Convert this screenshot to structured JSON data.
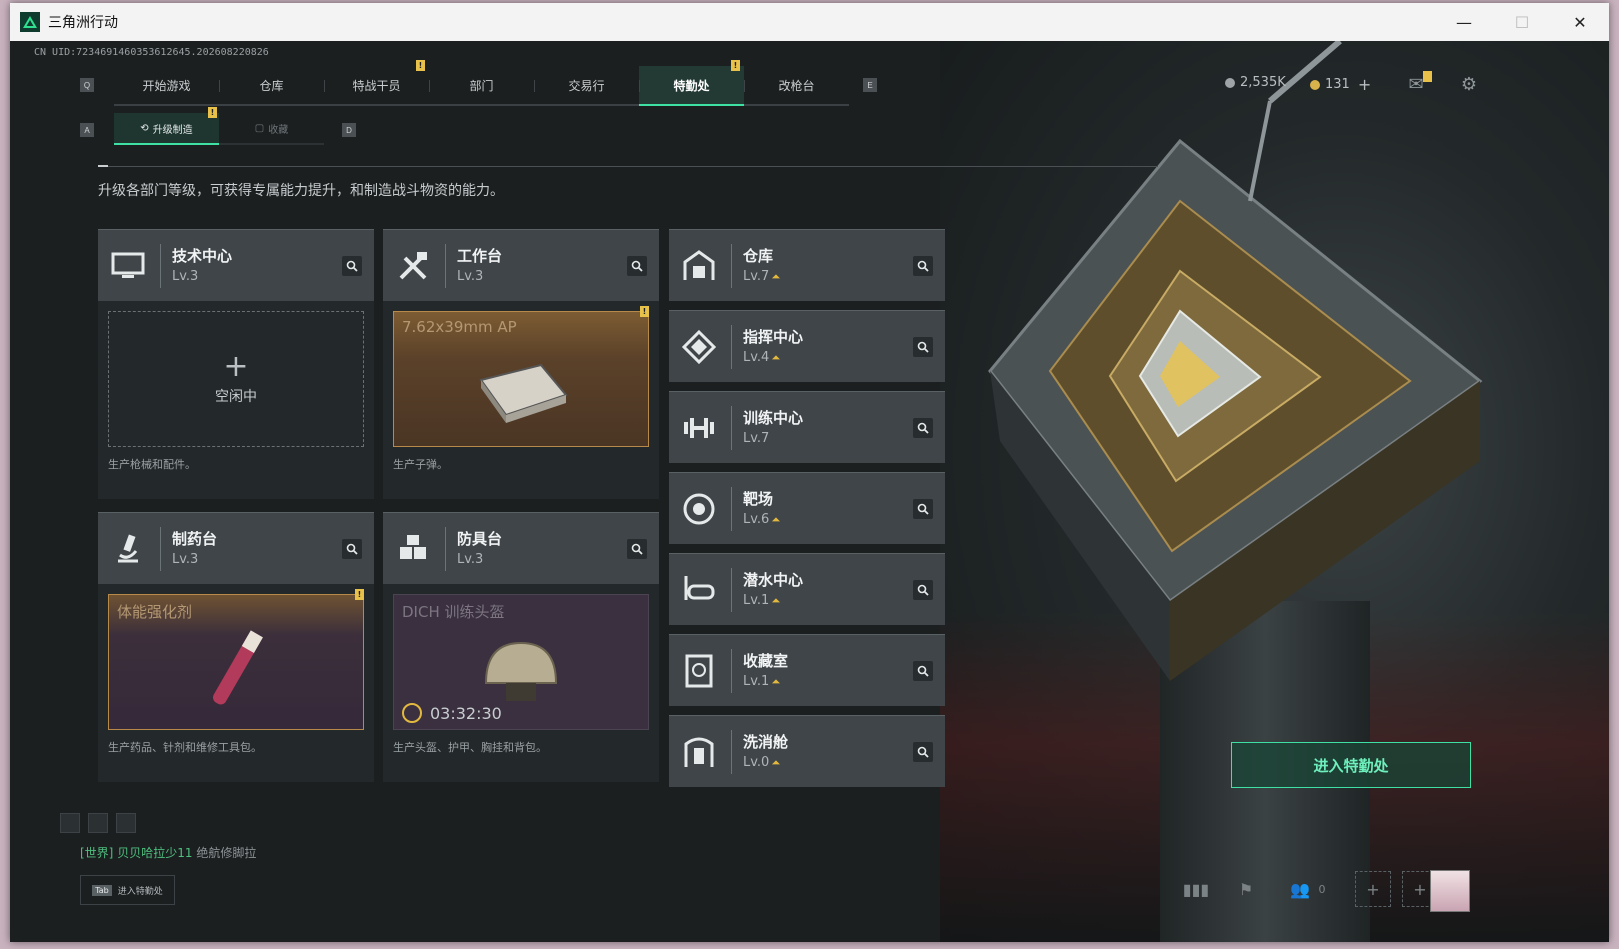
{
  "window": {
    "title": "三角洲行动",
    "minimize": "—",
    "maximize": "☐",
    "close": "✕"
  },
  "uid": "CN UID:7234691460353612645.202608220826",
  "key_hints": {
    "nav_left": "Q",
    "nav_right": "E",
    "sub_left": "A",
    "sub_right": "D"
  },
  "nav": {
    "tabs": [
      {
        "label": "开始游戏",
        "badge": ""
      },
      {
        "label": "仓库",
        "badge": ""
      },
      {
        "label": "特战干员",
        "badge": "!"
      },
      {
        "label": "部门",
        "badge": ""
      },
      {
        "label": "交易行",
        "badge": ""
      },
      {
        "label": "特勤处",
        "badge": "!",
        "active": true
      },
      {
        "label": "改枪台",
        "badge": ""
      }
    ]
  },
  "subnav": {
    "tabs": [
      {
        "label": "升级制造",
        "icon": "upgrade-icon",
        "badge": "!",
        "active": true
      },
      {
        "label": "收藏",
        "icon": "collection-icon"
      }
    ]
  },
  "currency": {
    "silver": "2,535K",
    "gold": "131",
    "add": "+"
  },
  "intro": "升级各部门等级，可获得专属能力提升，和制造战斗物资的能力。",
  "production": [
    {
      "name": "技术中心",
      "level": "Lv.3",
      "icon": "monitor-icon",
      "slot": {
        "state": "empty",
        "label": "空闲中",
        "plus": "+"
      },
      "desc": "生产枪械和配件。"
    },
    {
      "name": "工作台",
      "level": "Lv.3",
      "icon": "tools-icon",
      "slot": {
        "state": "ready",
        "item": "7.62x39mm AP",
        "badge": "!"
      },
      "desc": "生产子弹。"
    },
    {
      "name": "制药台",
      "level": "Lv.3",
      "icon": "microscope-icon",
      "slot": {
        "state": "ready",
        "item": "体能强化剂",
        "badge": "!"
      },
      "desc": "生产药品、针剂和维修工具包。"
    },
    {
      "name": "防具台",
      "level": "Lv.3",
      "icon": "armor-icon",
      "slot": {
        "state": "producing",
        "item": "DICH 训练头盔",
        "timer": "03:32:30"
      },
      "desc": "生产头盔、护甲、胸挂和背包。"
    }
  ],
  "facilities": [
    {
      "name": "仓库",
      "level": "Lv.7",
      "upgradable": true,
      "icon": "warehouse-icon"
    },
    {
      "name": "指挥中心",
      "level": "Lv.4",
      "upgradable": true,
      "icon": "command-icon"
    },
    {
      "name": "训练中心",
      "level": "Lv.7",
      "upgradable": false,
      "icon": "dumbbell-icon"
    },
    {
      "name": "靶场",
      "level": "Lv.6",
      "upgradable": true,
      "icon": "target-icon"
    },
    {
      "name": "潜水中心",
      "level": "Lv.1",
      "upgradable": true,
      "icon": "diving-icon"
    },
    {
      "name": "收藏室",
      "level": "Lv.1",
      "upgradable": true,
      "icon": "vault-icon"
    },
    {
      "name": "洗消舱",
      "level": "Lv.0",
      "upgradable": true,
      "icon": "decon-icon"
    }
  ],
  "enter_button": "进入特勤处",
  "chat": {
    "channel": "[世界]",
    "user": "贝贝哈拉少11",
    "message": "绝航修脚拉"
  },
  "tab_hint": {
    "key": "Tab",
    "label": "进入特勤处"
  },
  "social": {
    "friends_online": "0"
  }
}
